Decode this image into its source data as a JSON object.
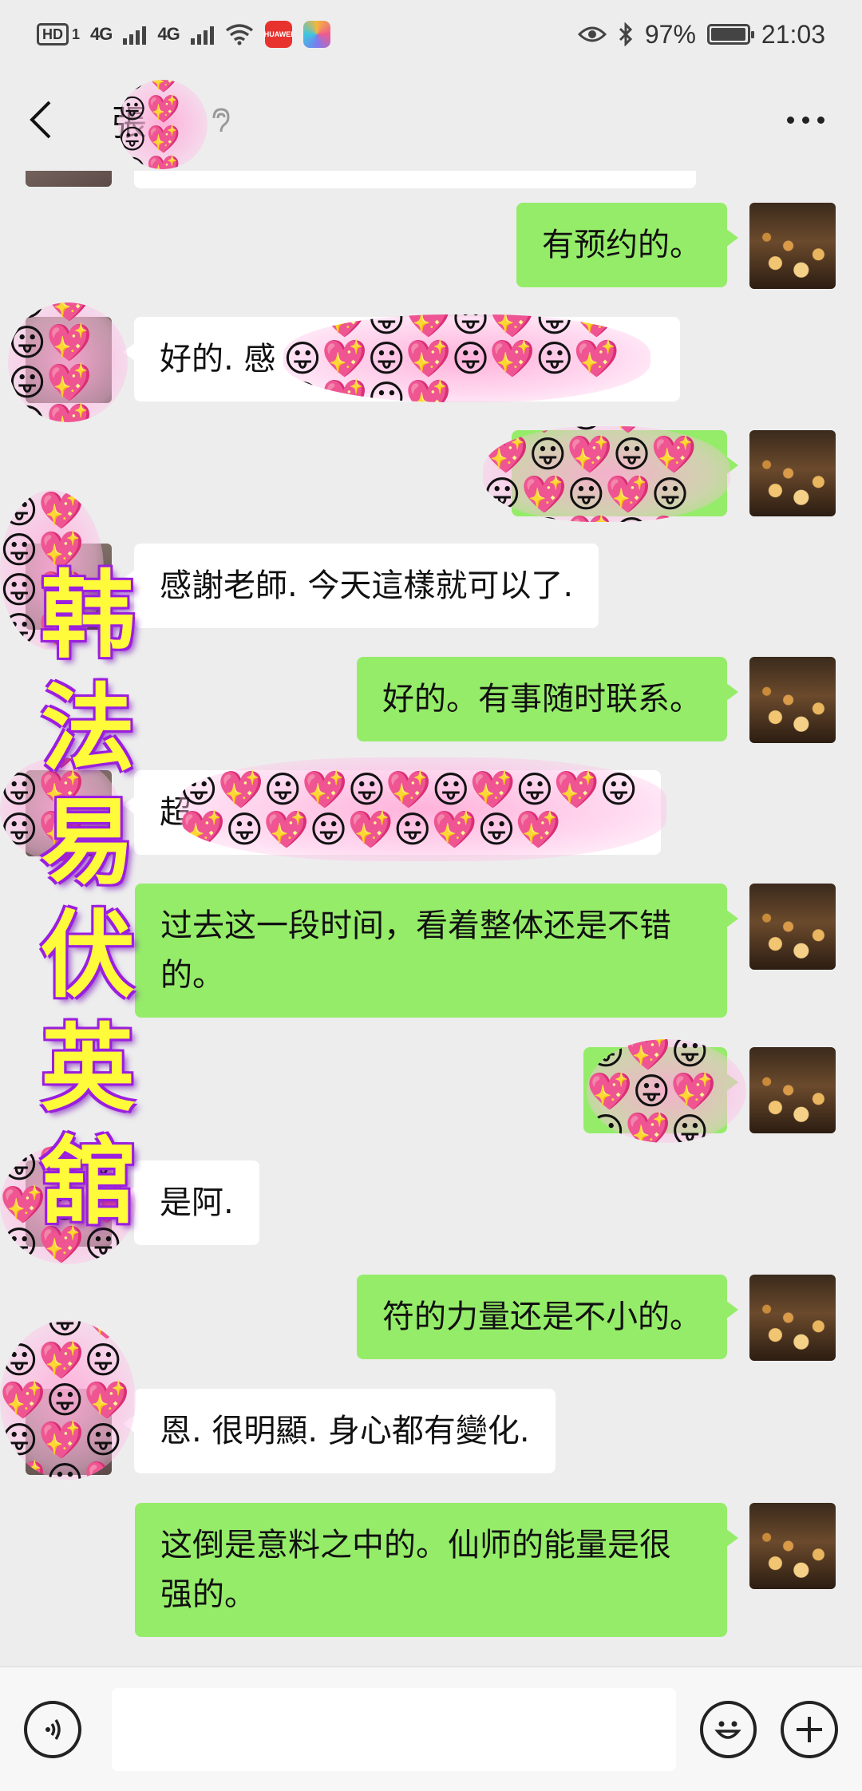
{
  "status_bar": {
    "left_badge": "HD",
    "left_badge_sub": "1",
    "signal1_label": "4G",
    "signal2_label": "4G",
    "app_icon_label": "HUAWEI",
    "battery_text": "97%",
    "battery_level": 0.97,
    "time": "21:03"
  },
  "header": {
    "title": "張"
  },
  "messages": [
    {
      "side": "right",
      "text": "有预约的。"
    },
    {
      "side": "left",
      "text": "好的. 感"
    },
    {
      "side": "right",
      "text": ""
    },
    {
      "side": "left",
      "text": "感謝老師. 今天這樣就可以了."
    },
    {
      "side": "right",
      "text": "好的。有事随时联系。"
    },
    {
      "side": "left",
      "text": "超"
    },
    {
      "side": "right",
      "text": "过去这一段时间，看着整体还是不错的。"
    },
    {
      "side": "right",
      "text": ""
    },
    {
      "side": "left",
      "text": "是阿."
    },
    {
      "side": "right",
      "text": "符的力量还是不小的。"
    },
    {
      "side": "left",
      "text": "恩. 很明顯. 身心都有變化."
    },
    {
      "side": "right",
      "text": "这倒是意料之中的。仙师的能量是很强的。"
    }
  ],
  "watermark": [
    "韩",
    "法",
    "易",
    "伏",
    "英",
    "舘"
  ],
  "sticker_emojis": "😛💖😛💖😛💖😛💖😛💖😛💖😛💖😛💖😛💖😛💖",
  "colors": {
    "bubble_right": "#95ec69",
    "bubble_left": "#ffffff",
    "background": "#ededed",
    "watermark_fill": "#fffb3a",
    "watermark_outline": "#9b1fe0"
  }
}
